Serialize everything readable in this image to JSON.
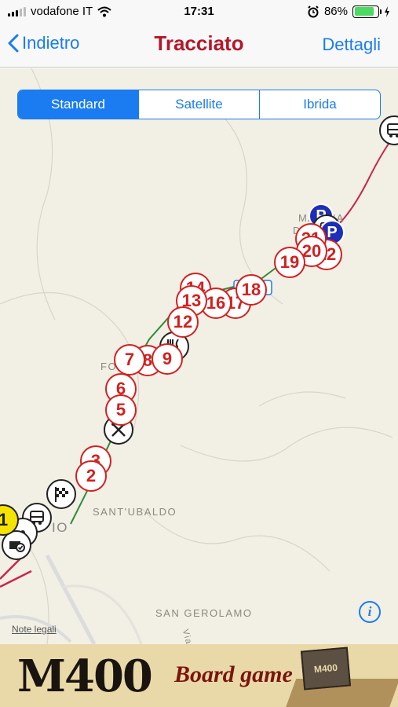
{
  "status_bar": {
    "carrier": "vodafone IT",
    "time": "17:31",
    "battery": "86%",
    "battery_level": 0.86
  },
  "nav": {
    "back_label": "Indietro",
    "title": "Tracciato",
    "right_label": "Dettagli"
  },
  "map_type": {
    "options": [
      "Standard",
      "Satellite",
      "Ibrida"
    ],
    "selected": "Standard"
  },
  "map_labels": {
    "place_1": "SANT'UBALDO",
    "place_2": "SAN GEROLAMO",
    "place_3_line1": "MA   NNA",
    "place_3_line2": "D       MA",
    "place_4": "FO",
    "place_5": "IO",
    "road_label": "Via"
  },
  "markers": [
    "1",
    "2",
    "3",
    "5",
    "6",
    "7",
    "8",
    "9",
    "12",
    "13",
    "14",
    "16",
    "17",
    "18",
    "19",
    "20",
    "21",
    "22"
  ],
  "map_footer": {
    "legal": "Note legali",
    "info_icon": "i"
  },
  "banner": {
    "logo": "M400",
    "subtitle": "Board game",
    "box_label": "M400"
  },
  "colors": {
    "accent": "#1a7cf0",
    "title": "#b2182b",
    "marker": "#d42020",
    "parking": "#1d2eb8",
    "route_before": "#c8264a",
    "route_after": "#2e8b3a"
  }
}
